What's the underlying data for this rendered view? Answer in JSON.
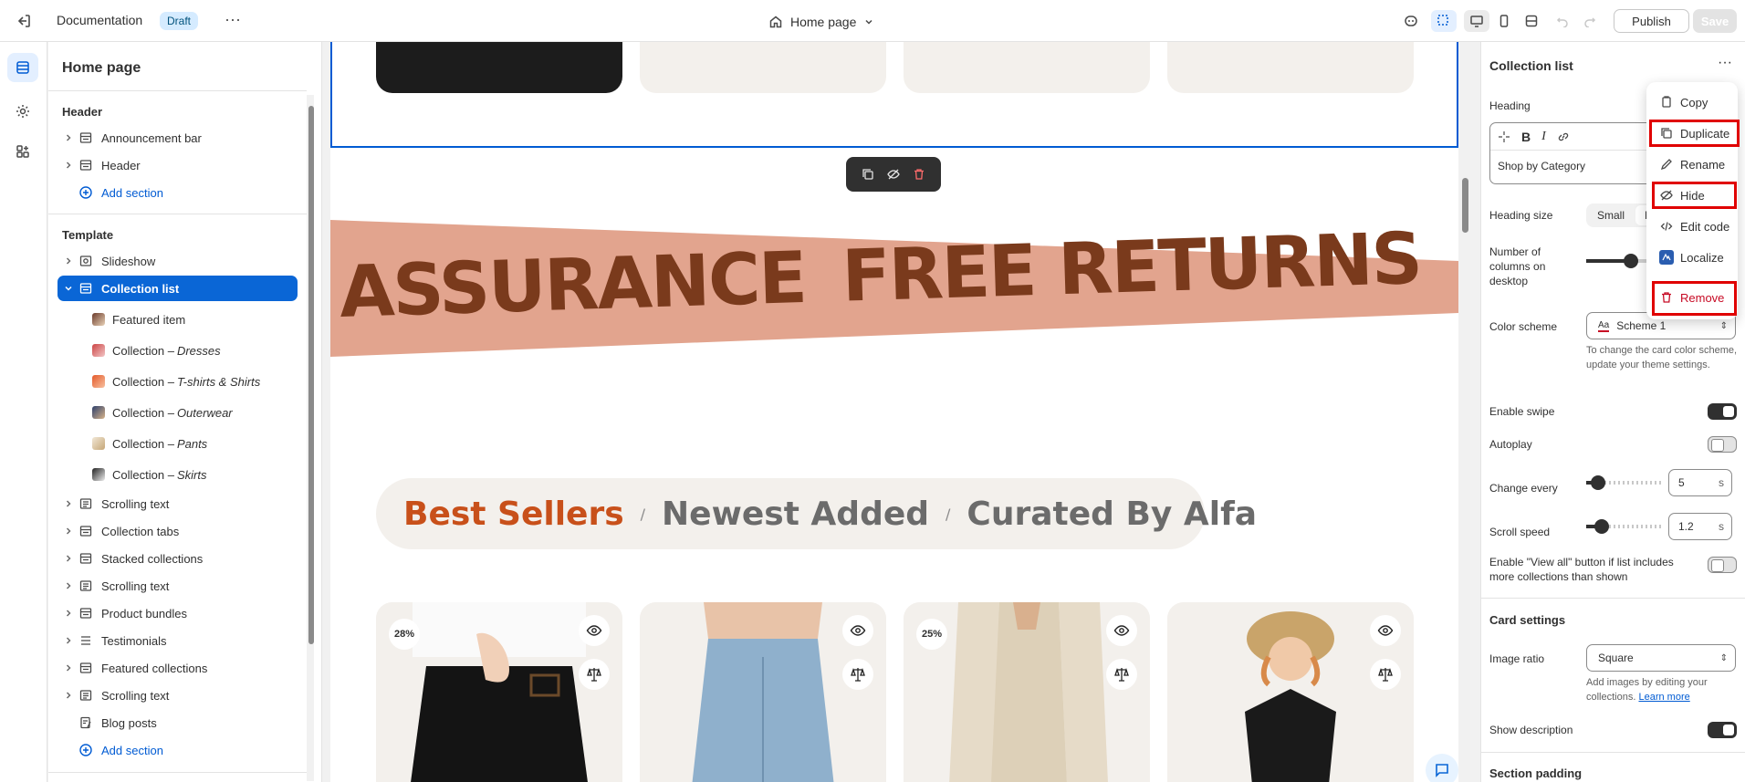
{
  "topbar": {
    "doc_title": "Documentation",
    "status_badge": "Draft",
    "page_selector": "Home page",
    "publish_label": "Publish",
    "save_label": "Save"
  },
  "sidebar": {
    "title": "Home page",
    "header_group": "Header",
    "header_items": [
      {
        "label": "Announcement bar",
        "icon": "section-icon"
      },
      {
        "label": "Header",
        "icon": "section-icon"
      }
    ],
    "add_section": "Add section",
    "template_group": "Template",
    "template_items": [
      {
        "label": "Slideshow",
        "icon": "slideshow-icon"
      },
      {
        "label": "Collection list",
        "icon": "section-icon",
        "selected": true
      }
    ],
    "children": [
      {
        "label": "Featured item",
        "italic": ""
      },
      {
        "label": "Collection – ",
        "italic": "Dresses"
      },
      {
        "label": "Collection – ",
        "italic": "T-shirts & Shirts"
      },
      {
        "label": "Collection – ",
        "italic": "Outerwear"
      },
      {
        "label": "Collection – ",
        "italic": "Pants"
      },
      {
        "label": "Collection – ",
        "italic": "Skirts"
      }
    ],
    "more_items": [
      {
        "label": "Scrolling text",
        "icon": "text-icon"
      },
      {
        "label": "Collection tabs",
        "icon": "section-icon"
      },
      {
        "label": "Stacked collections",
        "icon": "section-icon"
      },
      {
        "label": "Scrolling text",
        "icon": "text-icon"
      },
      {
        "label": "Product bundles",
        "icon": "section-icon"
      },
      {
        "label": "Testimonials",
        "icon": "list-icon"
      },
      {
        "label": "Featured collections",
        "icon": "section-icon"
      },
      {
        "label": "Scrolling text",
        "icon": "text-icon"
      }
    ],
    "blog_posts": "Blog posts",
    "add_section_2": "Add section"
  },
  "canvas": {
    "banner_text_1": "ASSURANCE",
    "banner_text_2": "FREE RETURNS",
    "tabs": [
      "Best Sellers",
      "Newest Added",
      "Curated By Alfa"
    ],
    "tab_separator": "/",
    "product_badges": [
      "28%",
      "",
      "25%",
      ""
    ]
  },
  "panel": {
    "title": "Collection list",
    "heading_label": "Heading",
    "heading_value": "Shop by Category",
    "heading_size_label": "Heading size",
    "heading_size_small": "Small",
    "heading_size_medium": "M",
    "columns_label": "Number of columns on desktop",
    "color_scheme_label": "Color scheme",
    "color_scheme_value": "Scheme 1",
    "color_scheme_swatch": "Aa",
    "color_scheme_help": "To change the card color scheme, update your theme settings.",
    "enable_swipe_label": "Enable swipe",
    "enable_swipe": true,
    "autoplay_label": "Autoplay",
    "autoplay": false,
    "change_every_label": "Change every",
    "change_every_value": "5",
    "change_every_unit": "s",
    "change_every_fraction": 0.15,
    "scroll_speed_label": "Scroll speed",
    "scroll_speed_value": "1.2",
    "scroll_speed_unit": "s",
    "scroll_speed_fraction": 0.2,
    "view_all_label": "Enable \"View all\" button if list includes more collections than shown",
    "view_all": false,
    "card_settings_title": "Card settings",
    "image_ratio_label": "Image ratio",
    "image_ratio_value": "Square",
    "image_ratio_help": "Add images by editing your collections.",
    "learn_more": "Learn more",
    "show_description_label": "Show description",
    "show_description": true,
    "section_padding_title": "Section padding"
  },
  "context_menu": {
    "items": [
      {
        "label": "Copy",
        "icon": "copy-icon"
      },
      {
        "label": "Duplicate",
        "icon": "duplicate-icon"
      },
      {
        "label": "Rename",
        "icon": "rename-icon"
      },
      {
        "label": "Hide",
        "icon": "eye-off-icon"
      },
      {
        "label": "Edit code",
        "icon": "code-icon"
      },
      {
        "label": "Localize",
        "icon": "localize-icon"
      },
      {
        "label": "Remove",
        "icon": "trash-icon"
      }
    ]
  },
  "colors": {
    "accent": "#0a66d6",
    "banner_bg": "#e2a48e",
    "banner_text": "#7a3a1c",
    "tab_active": "#c8501a",
    "danger": "#c70a24",
    "highlight": "#e00000"
  }
}
